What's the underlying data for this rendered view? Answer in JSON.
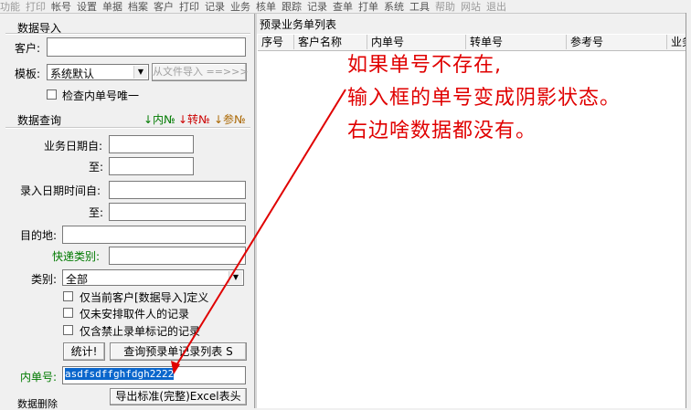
{
  "menubar": {
    "items": [
      "功能",
      "打印",
      "帐号",
      "设置",
      "单据",
      "档案",
      "客户",
      "打印",
      "记录",
      "业务",
      "核单",
      "跟踪",
      "记录",
      "查单",
      "打单",
      "系统",
      "工具",
      "帮助",
      "网站",
      "退出"
    ]
  },
  "import_section": {
    "title": "数据导入",
    "customer_label": "客户:",
    "customer_value": "",
    "template_label": "模板:",
    "template_value": "系统默认",
    "import_button": "从文件导入 ==>>>",
    "check_unique_label": "检查内单号唯一"
  },
  "query_section": {
    "title": "数据查询",
    "legend": {
      "inner": "↓内№",
      "transfer": "↓转№",
      "ref": "↓参№"
    },
    "biz_date_from_label": "业务日期自:",
    "to_label": "至:",
    "entry_time_from_label": "录入日期时间自:",
    "destination_label": "目的地:",
    "express_type_label": "快递类别:",
    "category_label": "类别:",
    "category_value": "全部",
    "only_current_customer_label": "仅当前客户[数据导入]定义",
    "only_unassigned_label": "仅未安排取件人的记录",
    "only_blocked_label": "仅含禁止录单标记的记录",
    "stats_button": "统计!",
    "query_button": "查询预录单记录列表 S",
    "inner_no_label": "内单号:",
    "inner_no_value": "asdfsdffghfdgh2222",
    "export_button": "导出标准(完整)Excel表头",
    "bottom_section_title": "数据删除"
  },
  "list": {
    "title": "预录业务单列表",
    "columns": [
      "序号",
      "客户名称",
      "内单号",
      "转单号",
      "参考号",
      "业务"
    ]
  },
  "annotation": {
    "line1": "如果单号不存在,",
    "line2": "输入框的单号变成阴影状态。",
    "line3": "右边啥数据都没有。",
    "color": "#e00000"
  }
}
